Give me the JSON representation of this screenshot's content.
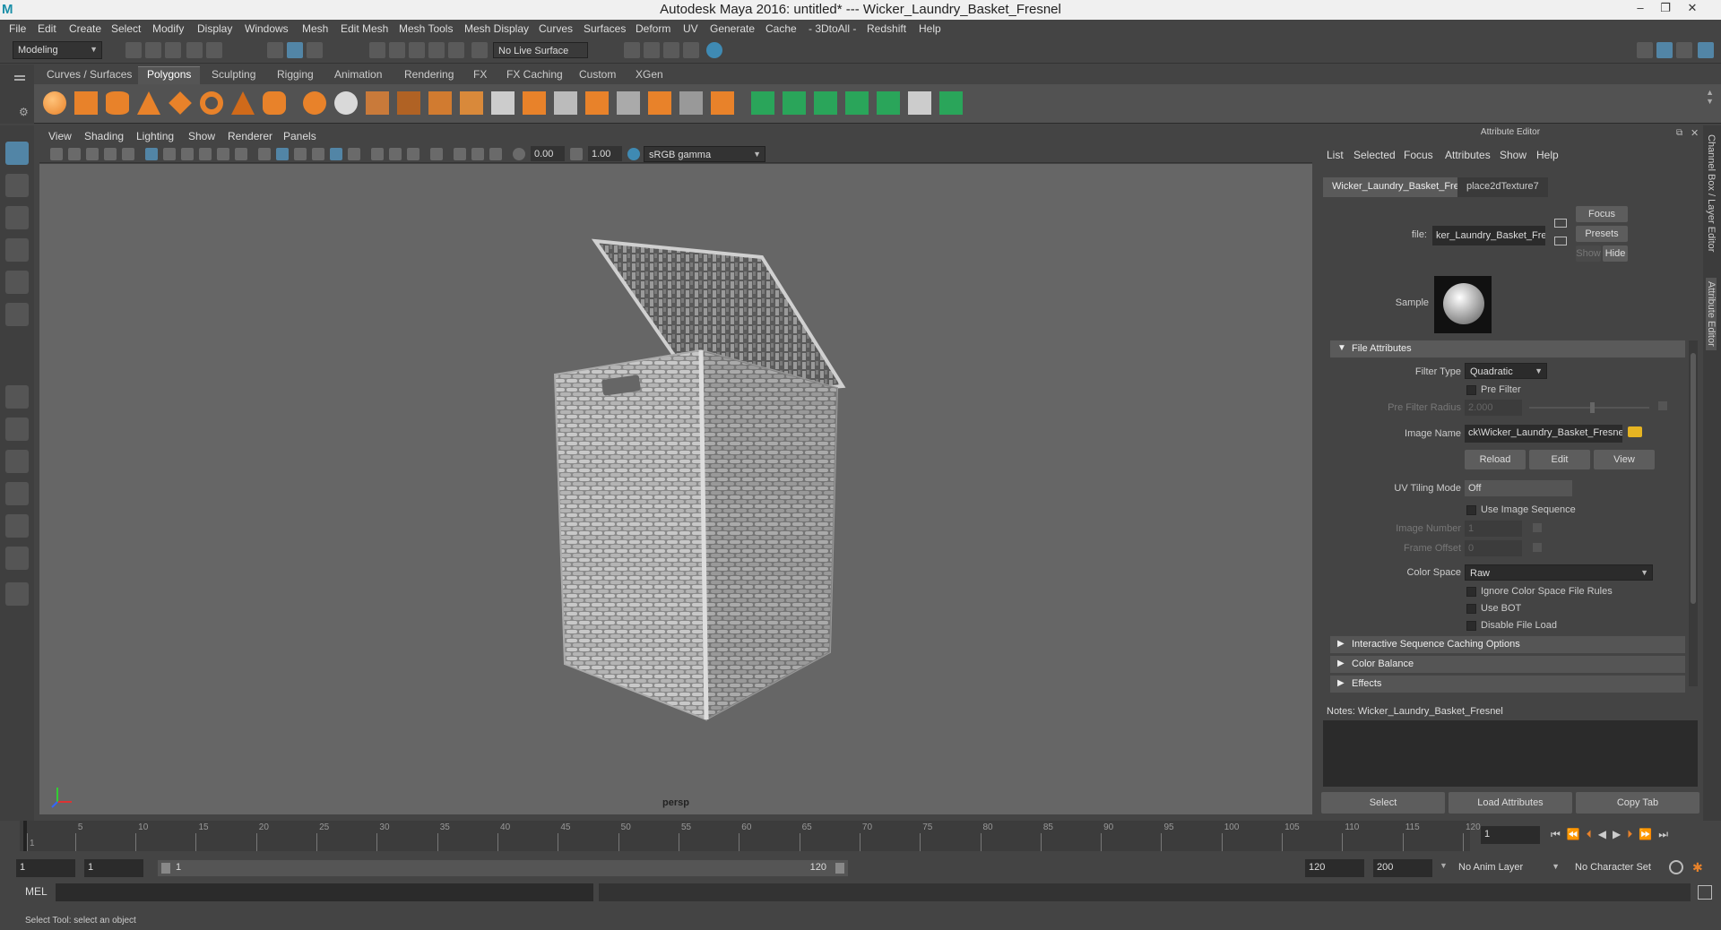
{
  "titlebar": {
    "title": "Autodesk Maya 2016: untitled*    ---    Wicker_Laundry_Basket_Fresnel"
  },
  "menubar": {
    "items": [
      "File",
      "Edit",
      "Create",
      "Select",
      "Modify",
      "Display",
      "Windows",
      "Mesh",
      "Edit Mesh",
      "Mesh Tools",
      "Mesh Display",
      "Curves",
      "Surfaces",
      "Deform",
      "UV",
      "Generate",
      "Cache",
      "- 3DtoAll -",
      "Redshift",
      "Help"
    ]
  },
  "statusline": {
    "mode": "Modeling",
    "live_surface": "No Live Surface"
  },
  "shelf": {
    "tabs": [
      "Curves / Surfaces",
      "Polygons",
      "Sculpting",
      "Rigging",
      "Animation",
      "Rendering",
      "FX",
      "FX Caching",
      "Custom",
      "XGen"
    ],
    "active_tab": "Polygons"
  },
  "viewport": {
    "menu": [
      "View",
      "Shading",
      "Lighting",
      "Show",
      "Renderer",
      "Panels"
    ],
    "exposure": "0.00",
    "gamma": "1.00",
    "color_space": "sRGB gamma",
    "camera_label": "persp"
  },
  "attribute_editor": {
    "header": "Attribute Editor",
    "menu": [
      "List",
      "Selected",
      "Focus",
      "Attributes",
      "Show",
      "Help"
    ],
    "tabs": [
      "Wicker_Laundry_Basket_Fresnel",
      "place2dTexture7"
    ],
    "file_label": "file:",
    "file_value": "ker_Laundry_Basket_Fresnel",
    "focus_btn": "Focus",
    "presets_btn": "Presets",
    "show_btn": "Show",
    "hide_btn": "Hide",
    "sample_label": "Sample",
    "file_attributes": "File Attributes",
    "filter_type_label": "Filter Type",
    "filter_type": "Quadratic",
    "pre_filter": "Pre Filter",
    "pre_filter_radius_label": "Pre Filter Radius",
    "pre_filter_radius": "2.000",
    "image_name_label": "Image Name",
    "image_name": "ck\\Wicker_Laundry_Basket_Fresnel.png",
    "reload": "Reload",
    "edit": "Edit",
    "view": "View",
    "uv_tiling_label": "UV Tiling Mode",
    "uv_tiling": "Off",
    "use_image_sequence": "Use Image Sequence",
    "image_number_label": "Image Number",
    "image_number": "1",
    "frame_offset_label": "Frame Offset",
    "frame_offset": "0",
    "color_space_label": "Color Space",
    "color_space": "Raw",
    "ignore_cs": "Ignore Color Space File Rules",
    "use_bot": "Use BOT",
    "disable_load": "Disable File Load",
    "sections": [
      "Interactive Sequence Caching Options",
      "Color Balance",
      "Effects"
    ],
    "notes": "Notes:  Wicker_Laundry_Basket_Fresnel",
    "select_btn": "Select",
    "load_attr_btn": "Load Attributes",
    "copy_tab_btn": "Copy Tab"
  },
  "side_tabs": [
    "Channel Box / Layer Editor",
    "Attribute Editor"
  ],
  "timeline": {
    "ticks": [
      "1",
      "5",
      "10",
      "15",
      "20",
      "25",
      "30",
      "35",
      "40",
      "45",
      "50",
      "55",
      "60",
      "65",
      "70",
      "75",
      "80",
      "85",
      "90",
      "95",
      "100",
      "105",
      "110",
      "115",
      "120"
    ],
    "current_frame": "1"
  },
  "range": {
    "start": "1",
    "start2": "1",
    "slider_start": "1",
    "slider_end": "120",
    "end": "120",
    "end2": "200",
    "anim_layer": "No Anim Layer",
    "char_set": "No Character Set"
  },
  "cmd": {
    "label": "MEL"
  },
  "helpline": {
    "text": "Select Tool: select an object"
  },
  "colors": {
    "accent_orange": "#e8822a",
    "accent_green": "#2aa55a",
    "maya_teal": "#1b8fa8"
  }
}
